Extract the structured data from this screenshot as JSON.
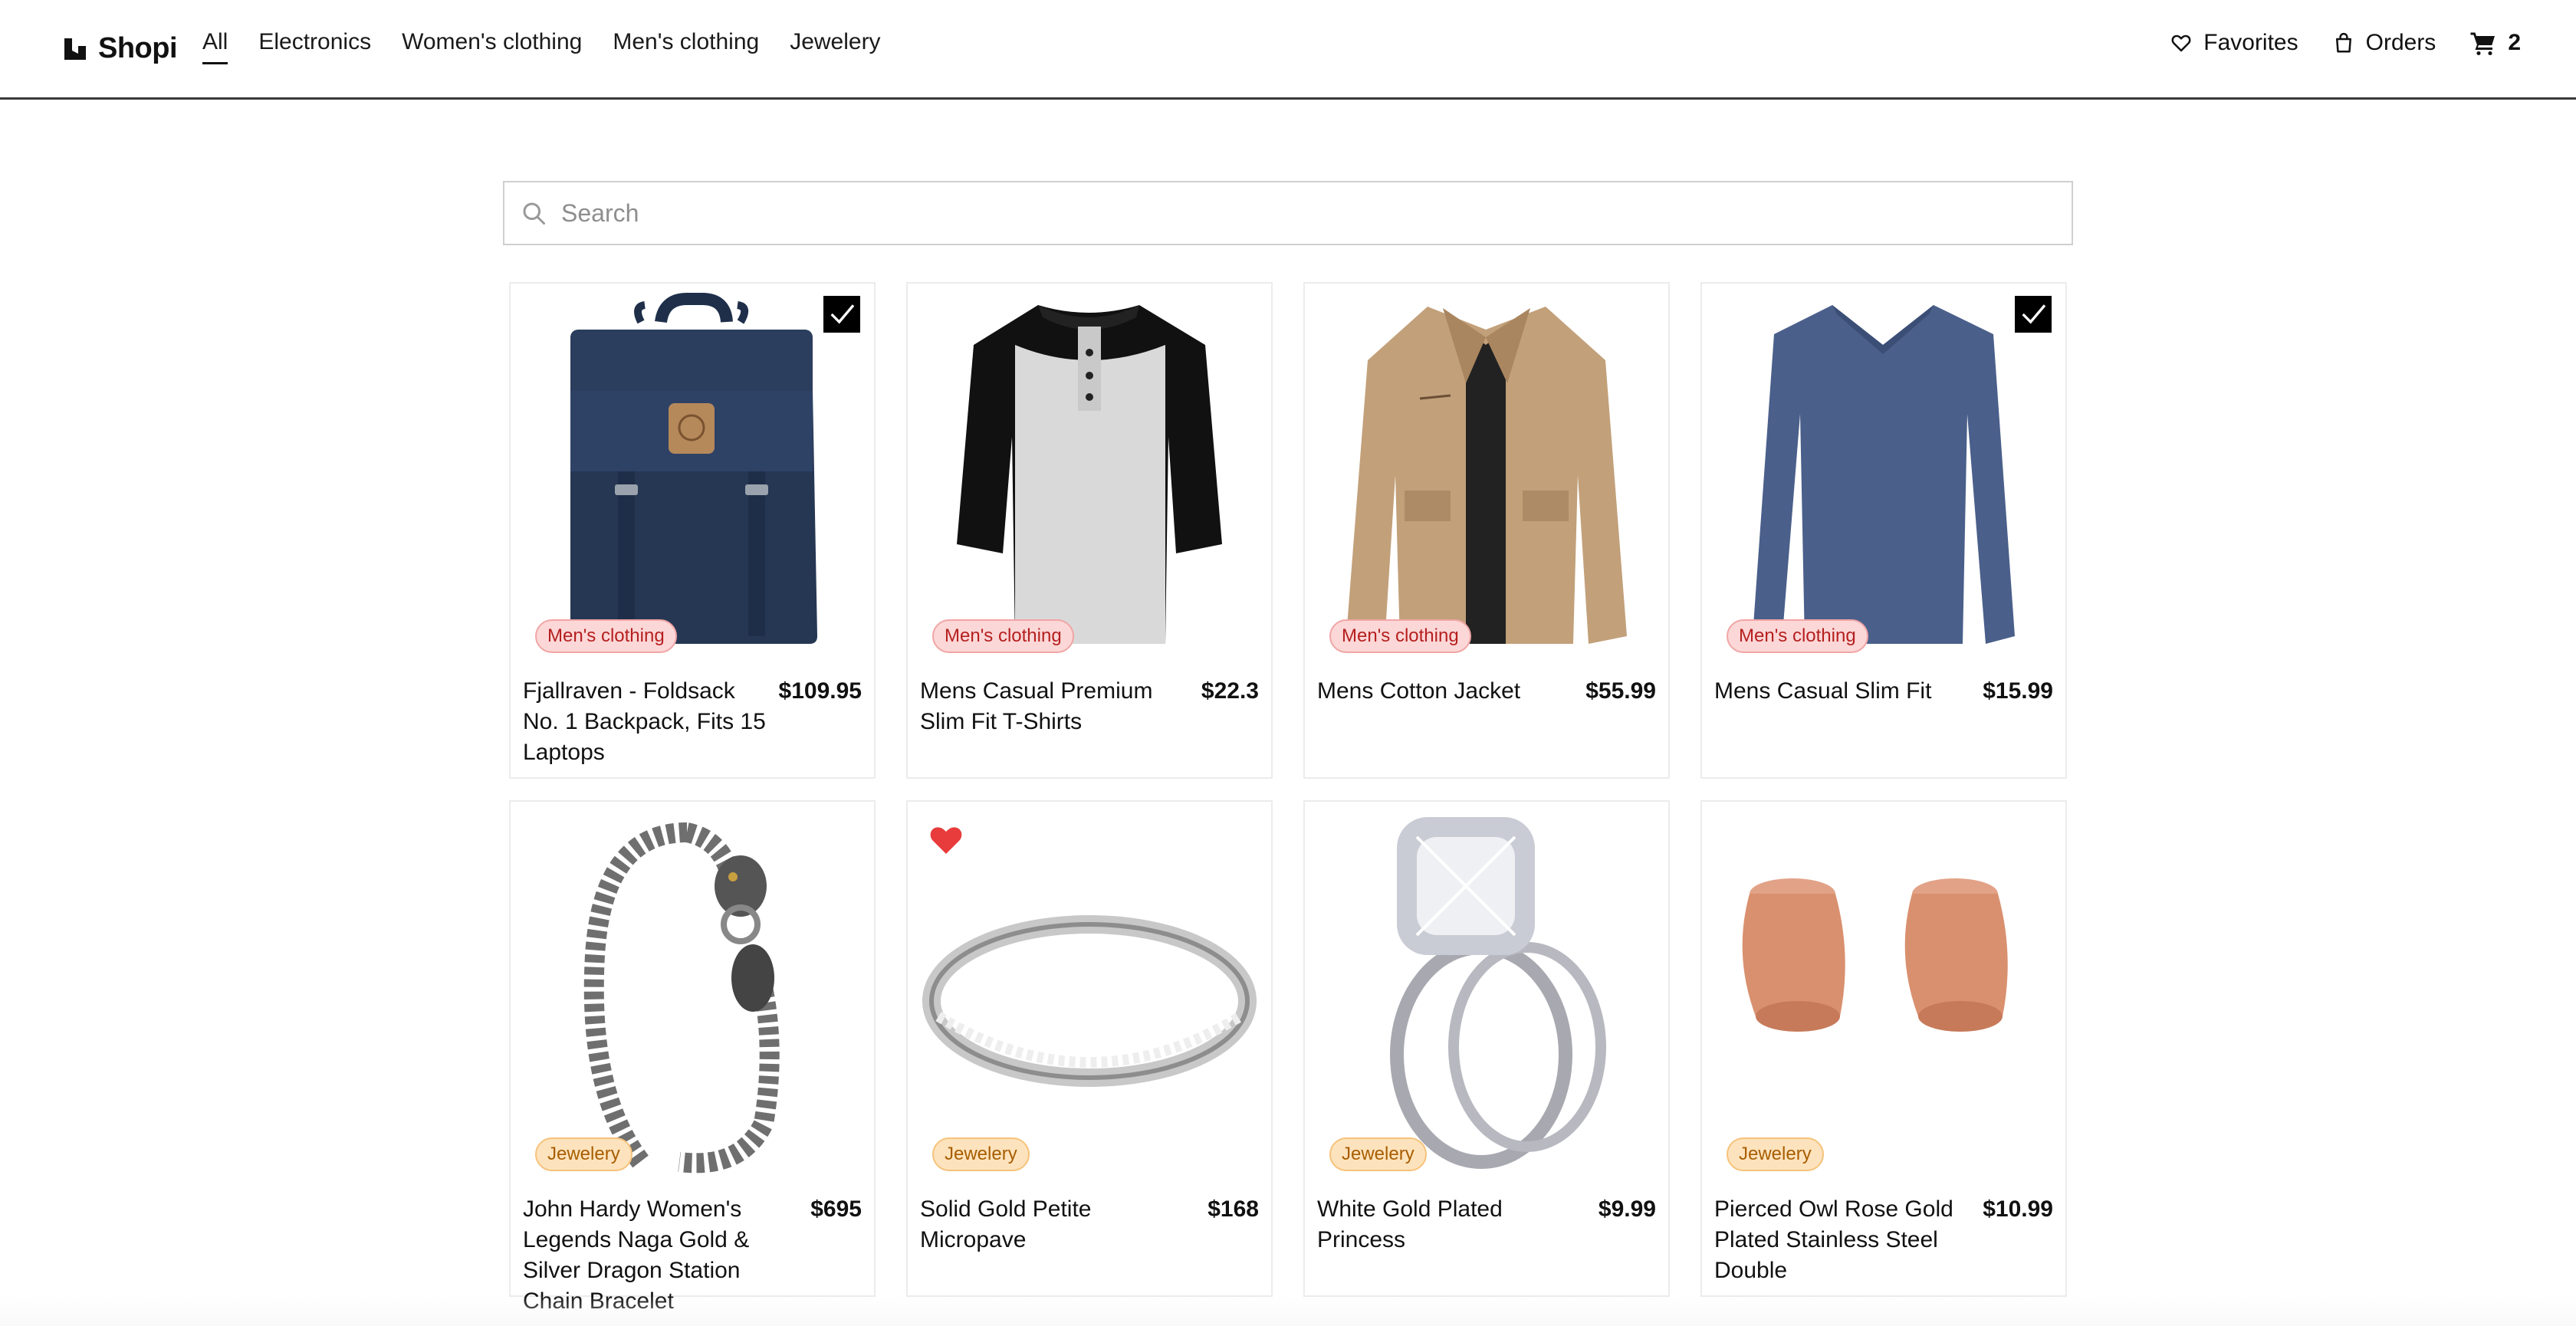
{
  "brand": {
    "name": "Shopi",
    "icon": "shopi-logo-icon"
  },
  "nav": {
    "categories": [
      "All",
      "Electronics",
      "Women's clothing",
      "Men's clothing",
      "Jewelery"
    ],
    "active": "All",
    "favorites_label": "Favorites",
    "orders_label": "Orders",
    "cart_count": "2"
  },
  "search": {
    "placeholder": "Search",
    "value": ""
  },
  "products": [
    {
      "title": "Fjallraven - Foldsack No. 1 Backpack, Fits 15 Laptops",
      "price": "$109.95",
      "category": "Men's clothing",
      "state": "in-cart"
    },
    {
      "title": "Mens Casual Premium Slim Fit T-Shirts",
      "price": "$22.3",
      "category": "Men's clothing",
      "state": "none"
    },
    {
      "title": "Mens Cotton Jacket",
      "price": "$55.99",
      "category": "Men's clothing",
      "state": "none"
    },
    {
      "title": "Mens Casual Slim Fit",
      "price": "$15.99",
      "category": "Men's clothing",
      "state": "in-cart"
    },
    {
      "title": "John Hardy Women's Legends Naga Gold & Silver Dragon Station Chain Bracelet",
      "price": "$695",
      "category": "Jewelery",
      "state": "none"
    },
    {
      "title": "Solid Gold Petite Micropave",
      "price": "$168",
      "category": "Jewelery",
      "state": "favorite"
    },
    {
      "title": "White Gold Plated Princess",
      "price": "$9.99",
      "category": "Jewelery",
      "state": "none"
    },
    {
      "title": "Pierced Owl Rose Gold Plated Stainless Steel Double",
      "price": "$10.99",
      "category": "Jewelery",
      "state": "none"
    }
  ],
  "colors": {
    "mens_badge_bg": "#fcd7d7",
    "jewelery_badge_bg": "#fde3bd",
    "favorite_heart": "#e83b3b",
    "cart_check_bg": "#000000"
  }
}
